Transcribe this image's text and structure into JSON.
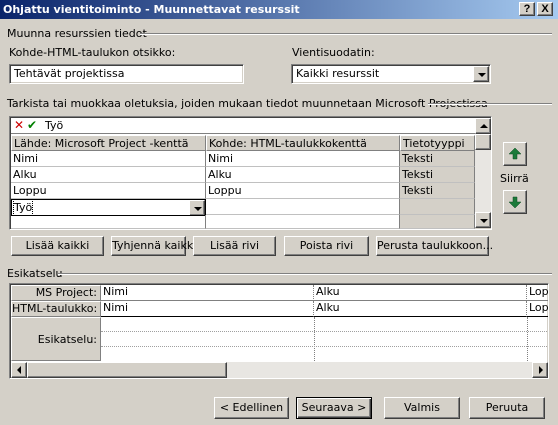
{
  "window": {
    "title": "Ohjattu vientitoiminto - Muunnettavat resurssit",
    "help_btn": "?",
    "close_btn": "X"
  },
  "section": {
    "title": "Muunna resurssien tiedot"
  },
  "dest_table": {
    "label": "Kohde-HTML-taulukon otsikko:",
    "value": "Tehtävät projektissa"
  },
  "export_filter": {
    "label": "Vientisuodatin:",
    "value": "Kaikki resurssit"
  },
  "mapping": {
    "instructions": "Tarkista tai muokkaa oletuksia, joiden mukaan tiedot muunnetaan Microsoft Projectissa",
    "edit_value": "Työ",
    "headers": [
      "Lähde: Microsoft Project -kenttä",
      "Kohde:  HTML-taulukkokenttä",
      "Tietotyyppi"
    ],
    "rows": [
      {
        "source": "Nimi",
        "dest": "Nimi",
        "type": "Teksti"
      },
      {
        "source": "Alku",
        "dest": "Alku",
        "type": "Teksti"
      },
      {
        "source": "Loppu",
        "dest": "Loppu",
        "type": "Teksti"
      }
    ],
    "active_row_value": "Työ"
  },
  "move": {
    "label": "Siirrä"
  },
  "buttons": {
    "add_all": "Lisää kaikki",
    "clear_all": "Tyhjennä kaikki",
    "insert_row": "Lisää rivi",
    "delete_row": "Poista rivi",
    "base_on_table": "Perusta taulukkoon..."
  },
  "preview": {
    "title": "Esikatselu",
    "row_labels": [
      "MS Project:",
      "HTML-taulukko:",
      "Esikatselu:"
    ],
    "columns": [
      "Nimi",
      "Alku",
      "Lop"
    ],
    "html_columns": [
      "Nimi",
      "Alku",
      "Lop"
    ]
  },
  "footer": {
    "back": "< Edellinen",
    "next": "Seuraava >",
    "finish": "Valmis",
    "cancel": "Peruuta"
  },
  "colors": {
    "titlebar_start": "#0a246a",
    "titlebar_end": "#a6caf0",
    "dialog_bg": "#d4d0c8",
    "cancel_x": "#cc0000",
    "accept_check": "#008000",
    "arrow_green": "#1c7a3a"
  }
}
